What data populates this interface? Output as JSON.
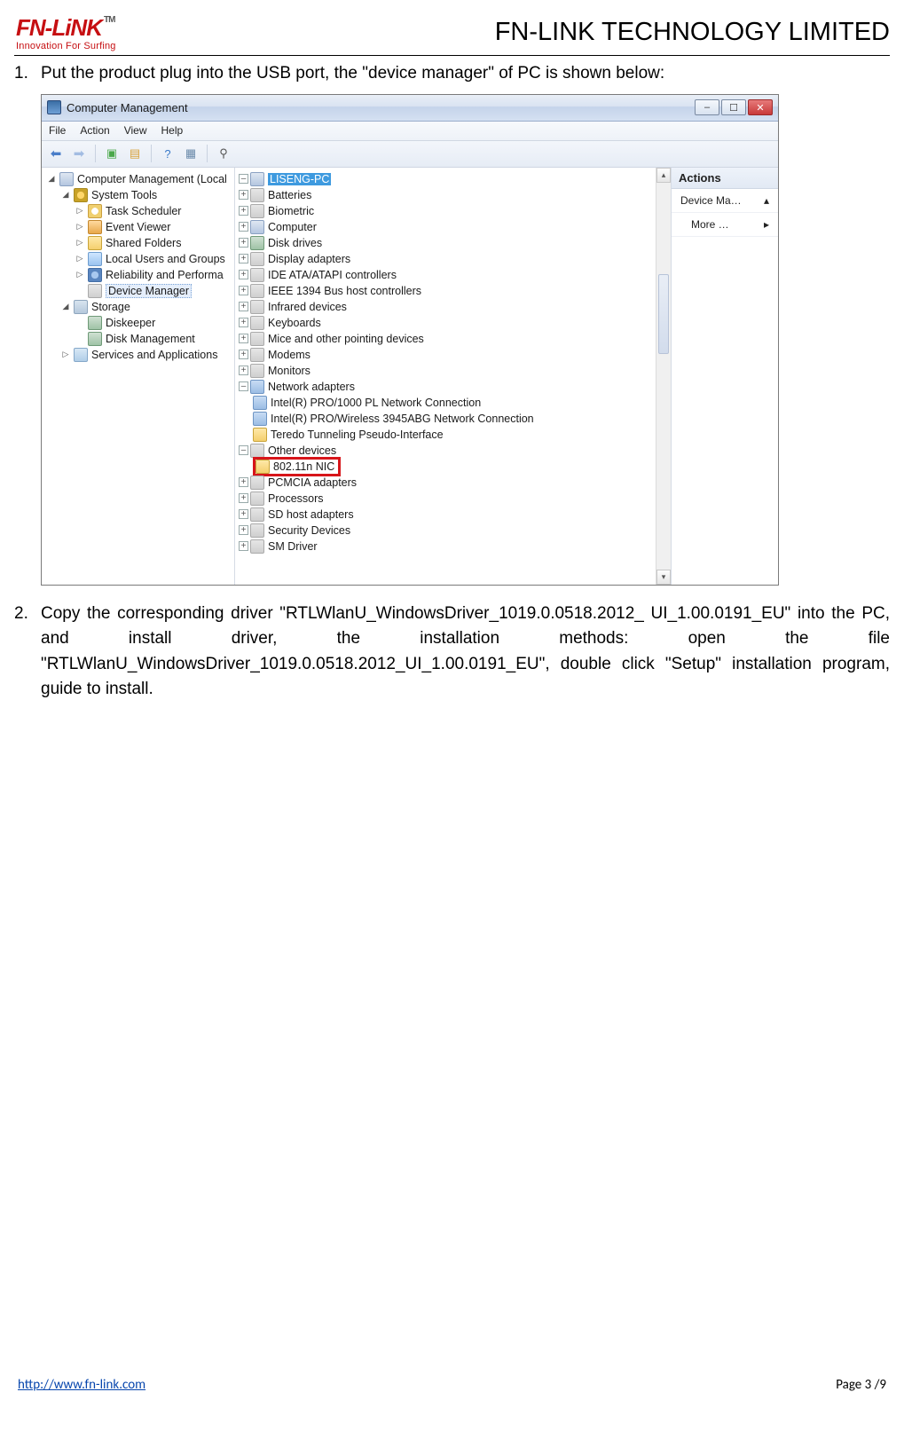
{
  "header": {
    "logo_text": "FN-LiNK",
    "tm": "TM",
    "tagline": "Innovation For Surfing",
    "company": "FN-LINK TECHNOLOGY LIMITED"
  },
  "steps": {
    "s1_num": "1.",
    "s1_text": "Put the product plug into the USB port, the \"device manager\" of PC is shown below:",
    "s2_num": "2.",
    "s2_text": "Copy the corresponding driver \"RTLWlanU_WindowsDriver_1019.0.0518.2012_ UI_1.00.0191_EU\" into the PC, and install driver, the installation methods: open the file \"RTLWlanU_WindowsDriver_1019.0.0518.2012_UI_1.00.0191_EU\", double click \"Setup\" installation program, guide to install."
  },
  "win": {
    "title": "Computer Management",
    "menus": {
      "file": "File",
      "action": "Action",
      "view": "View",
      "help": "Help"
    },
    "btn_min": "–",
    "btn_max": "☐",
    "btn_close": "✕"
  },
  "left_tree": {
    "root": "Computer Management (Local",
    "sys": "System Tools",
    "task": "Task Scheduler",
    "event": "Event Viewer",
    "shared": "Shared Folders",
    "users": "Local Users and Groups",
    "rel": "Reliability and Performa",
    "devm": "Device Manager",
    "stor": "Storage",
    "dk": "Diskeeper",
    "diskm": "Disk Management",
    "svc": "Services and Applications"
  },
  "mid_tree": {
    "root": "LISENG-PC",
    "items": [
      "Batteries",
      "Biometric",
      "Computer",
      "Disk drives",
      "Display adapters",
      "IDE ATA/ATAPI controllers",
      "IEEE 1394 Bus host controllers",
      "Infrared devices",
      "Keyboards",
      "Mice and other pointing devices",
      "Modems",
      "Monitors"
    ],
    "net": "Network adapters",
    "net_children": [
      "Intel(R) PRO/1000 PL Network Connection",
      "Intel(R) PRO/Wireless 3945ABG Network Connection",
      "Teredo Tunneling Pseudo-Interface"
    ],
    "other": "Other devices",
    "other_child": "802.11n NIC",
    "tail": [
      "PCMCIA adapters",
      "Processors",
      "SD host adapters",
      "Security Devices",
      "SM Driver"
    ]
  },
  "actions": {
    "hdr": "Actions",
    "item1": "Device Ma…",
    "item1_sym": "▴",
    "item2": "More …",
    "item2_sym": "▸"
  },
  "footer": {
    "url": "http://www.fn-link.com",
    "page": "Page 3 /9"
  }
}
